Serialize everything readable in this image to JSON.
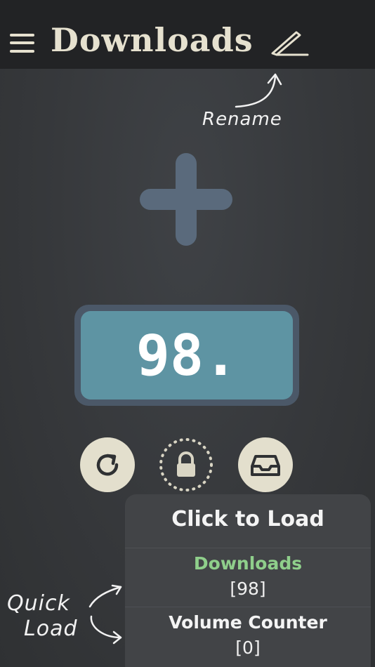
{
  "header": {
    "title": "Downloads",
    "menu_icon": "hamburger-menu-icon",
    "edit_icon": "pencil-icon"
  },
  "annotations": {
    "rename": "Rename",
    "quick": "Quick",
    "load": "Load"
  },
  "counter": {
    "value": "98."
  },
  "actions": {
    "refresh_icon": "refresh-icon",
    "lock_icon": "lock-icon",
    "inbox_icon": "inbox-icon"
  },
  "load_panel": {
    "title": "Click to Load",
    "items": [
      {
        "name": "Downloads",
        "count": "[98]",
        "color": "#8fcf8b"
      },
      {
        "name": "Volume Counter",
        "count": "[0]",
        "color": "#f4f4f4"
      }
    ]
  },
  "colors": {
    "topbar": "#222325",
    "title": "#e6e1cf",
    "counter_bg": "#5e94a3",
    "accent_green": "#8fcf8b"
  }
}
